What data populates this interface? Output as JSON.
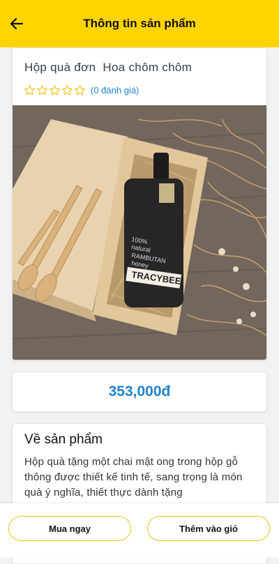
{
  "header": {
    "title": "Thông tin sản phẩm",
    "back_icon": "arrow-left-icon"
  },
  "product": {
    "name": "Hộp quà đơn  Hoa chôm chôm",
    "rating": 0,
    "rating_max": 5,
    "rating_count_text": "(0 đánh giá)",
    "star_color": "#f2c014",
    "image_label_lines": [
      "100%",
      "natural",
      "RAMBUTAN",
      "honey"
    ],
    "image_brand": "TRACYBEE"
  },
  "price": {
    "text": "353,000đ",
    "color": "#1f84cf"
  },
  "about": {
    "heading": "Về sản phẩm",
    "description": "Hộp quà tặng một chai mật ong trong hộp gỗ thông được thiết kế tinh tế, sang trọng là món quà ý nghĩa, thiết thực dành tặng"
  },
  "actions": {
    "buy_now_label": "Mua ngay",
    "add_to_cart_label": "Thêm vào giỏ",
    "accent": "#f2c014"
  },
  "colors": {
    "header_bg": "#ffd400"
  }
}
